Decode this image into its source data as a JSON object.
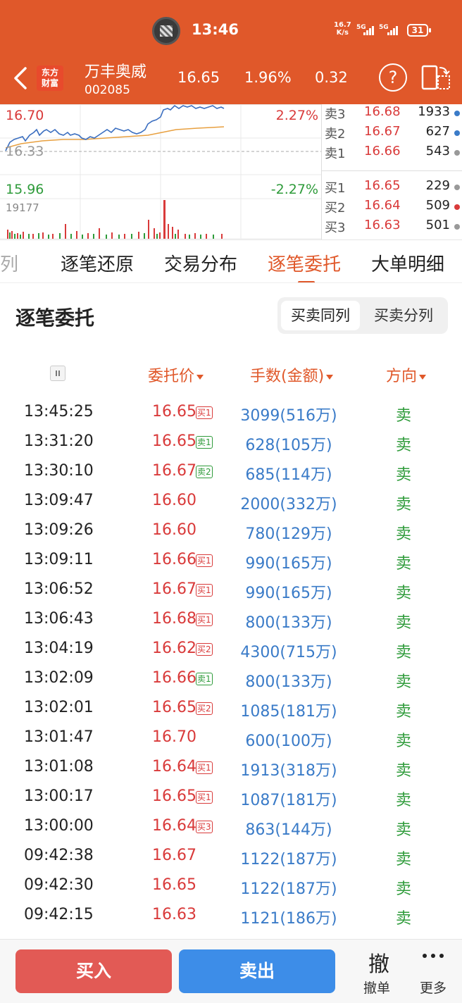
{
  "status_bar": {
    "time": "13:46",
    "speed_value": "16.7",
    "speed_unit": "K/s",
    "sim1": "5G",
    "sim2": "5G",
    "battery": "31"
  },
  "header": {
    "logo_line1": "东方",
    "logo_line2": "财富",
    "stock_name": "万丰奥威",
    "stock_code": "002085",
    "price": "16.65",
    "change_pct": "1.96%",
    "change": "0.32"
  },
  "chart": {
    "high_price": "16.70",
    "high_pct": "2.27%",
    "mid_price": "16.33",
    "low_price": "15.96",
    "low_pct": "-2.27%",
    "volume_max": "19177"
  },
  "order_book": {
    "asks": [
      {
        "label": "卖3",
        "price": "16.68",
        "volume": "1933"
      },
      {
        "label": "卖2",
        "price": "16.67",
        "volume": "627"
      },
      {
        "label": "卖1",
        "price": "16.66",
        "volume": "543"
      }
    ],
    "bids": [
      {
        "label": "买1",
        "price": "16.65",
        "volume": "229"
      },
      {
        "label": "买2",
        "price": "16.64",
        "volume": "509"
      },
      {
        "label": "买3",
        "price": "16.63",
        "volume": "501"
      }
    ],
    "dot_colors": {
      "blue": "#3a7bc8",
      "gray": "#999999",
      "red": "#d93a3a"
    }
  },
  "tabs": [
    "队列",
    "逐笔还原",
    "交易分布",
    "逐笔委托",
    "大单明细"
  ],
  "active_tab": "逐笔委托",
  "section": {
    "title": "逐笔委托",
    "toggle_on": "买卖同列",
    "toggle_off": "买卖分列"
  },
  "columns": {
    "price": "委托价",
    "volume": "手数(金额)",
    "direction": "方向"
  },
  "rows": [
    {
      "time": "13:45:25",
      "price": "16.65",
      "tag": "买1",
      "tag_type": "buy",
      "volume": "3099(516万)",
      "dir": "卖"
    },
    {
      "time": "13:31:20",
      "price": "16.65",
      "tag": "卖1",
      "tag_type": "sell",
      "volume": "628(105万)",
      "dir": "卖"
    },
    {
      "time": "13:30:10",
      "price": "16.67",
      "tag": "卖2",
      "tag_type": "sell",
      "volume": "685(114万)",
      "dir": "卖"
    },
    {
      "time": "13:09:47",
      "price": "16.60",
      "tag": "",
      "tag_type": "",
      "volume": "2000(332万)",
      "dir": "卖"
    },
    {
      "time": "13:09:26",
      "price": "16.60",
      "tag": "",
      "tag_type": "",
      "volume": "780(129万)",
      "dir": "卖"
    },
    {
      "time": "13:09:11",
      "price": "16.66",
      "tag": "买1",
      "tag_type": "buy",
      "volume": "990(165万)",
      "dir": "卖"
    },
    {
      "time": "13:06:52",
      "price": "16.67",
      "tag": "买1",
      "tag_type": "buy",
      "volume": "990(165万)",
      "dir": "卖"
    },
    {
      "time": "13:06:43",
      "price": "16.68",
      "tag": "买1",
      "tag_type": "buy",
      "volume": "800(133万)",
      "dir": "卖"
    },
    {
      "time": "13:04:19",
      "price": "16.62",
      "tag": "买2",
      "tag_type": "buy",
      "volume": "4300(715万)",
      "dir": "卖"
    },
    {
      "time": "13:02:09",
      "price": "16.66",
      "tag": "卖1",
      "tag_type": "sell",
      "volume": "800(133万)",
      "dir": "卖"
    },
    {
      "time": "13:02:01",
      "price": "16.65",
      "tag": "买2",
      "tag_type": "buy",
      "volume": "1085(181万)",
      "dir": "卖"
    },
    {
      "time": "13:01:47",
      "price": "16.70",
      "tag": "",
      "tag_type": "",
      "volume": "600(100万)",
      "dir": "卖"
    },
    {
      "time": "13:01:08",
      "price": "16.64",
      "tag": "买1",
      "tag_type": "buy",
      "volume": "1913(318万)",
      "dir": "卖"
    },
    {
      "time": "13:00:17",
      "price": "16.65",
      "tag": "买1",
      "tag_type": "buy",
      "volume": "1087(181万)",
      "dir": "卖"
    },
    {
      "time": "13:00:00",
      "price": "16.64",
      "tag": "买3",
      "tag_type": "buy",
      "volume": "863(144万)",
      "dir": "卖"
    },
    {
      "time": "09:42:38",
      "price": "16.67",
      "tag": "",
      "tag_type": "",
      "volume": "1122(187万)",
      "dir": "卖"
    },
    {
      "time": "09:42:30",
      "price": "16.65",
      "tag": "",
      "tag_type": "",
      "volume": "1122(187万)",
      "dir": "卖"
    },
    {
      "time": "09:42:15",
      "price": "16.63",
      "tag": "",
      "tag_type": "",
      "volume": "1121(186万)",
      "dir": "卖"
    }
  ],
  "bottom": {
    "buy": "买入",
    "sell": "卖出",
    "cancel_icon_char": "撤",
    "cancel_label": "撤单",
    "more_label": "更多"
  },
  "colors": {
    "brand": "#e0582a",
    "up": "#d93a3a",
    "down": "#2e9b3a",
    "link": "#3a7bc8"
  }
}
